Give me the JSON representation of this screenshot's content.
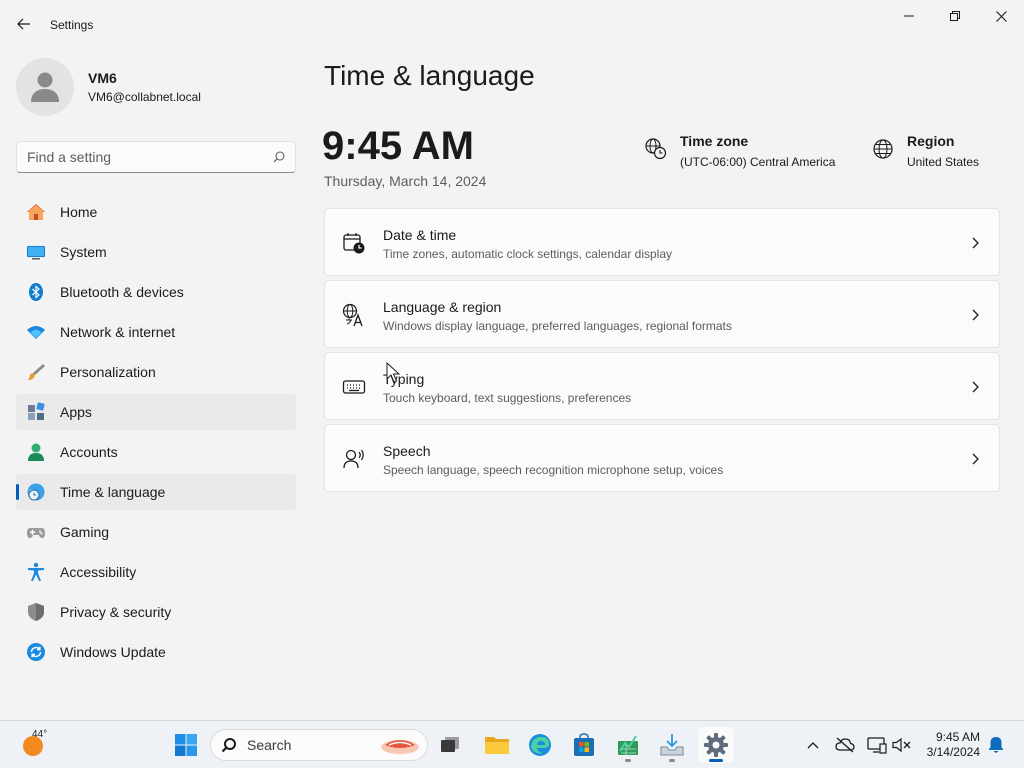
{
  "window": {
    "title": "Settings"
  },
  "user": {
    "name": "VM6",
    "email": "VM6@collabnet.local"
  },
  "search": {
    "placeholder": "Find a setting"
  },
  "sidebar": {
    "items": [
      {
        "label": "Home",
        "icon": "home-icon"
      },
      {
        "label": "System",
        "icon": "system-icon"
      },
      {
        "label": "Bluetooth & devices",
        "icon": "bluetooth-icon"
      },
      {
        "label": "Network & internet",
        "icon": "wifi-icon"
      },
      {
        "label": "Personalization",
        "icon": "brush-icon"
      },
      {
        "label": "Apps",
        "icon": "apps-icon"
      },
      {
        "label": "Accounts",
        "icon": "accounts-icon"
      },
      {
        "label": "Time & language",
        "icon": "time-language-icon",
        "active": true
      },
      {
        "label": "Gaming",
        "icon": "gamepad-icon"
      },
      {
        "label": "Accessibility",
        "icon": "accessibility-icon"
      },
      {
        "label": "Privacy & security",
        "icon": "shield-icon"
      },
      {
        "label": "Windows Update",
        "icon": "update-icon"
      }
    ]
  },
  "main": {
    "title": "Time & language",
    "clock": "9:45 AM",
    "date": "Thursday, March 14, 2024",
    "time_zone": {
      "label": "Time zone",
      "value": "(UTC-06:00) Central America"
    },
    "region": {
      "label": "Region",
      "value": "United States"
    },
    "cards": [
      {
        "title": "Date & time",
        "description": "Time zones, automatic clock settings, calendar display",
        "icon": "calendar-clock-icon"
      },
      {
        "title": "Language & region",
        "description": "Windows display language, preferred languages, regional formats",
        "icon": "language-icon"
      },
      {
        "title": "Typing",
        "description": "Touch keyboard, text suggestions, preferences",
        "icon": "keyboard-icon"
      },
      {
        "title": "Speech",
        "description": "Speech language, speech recognition microphone setup, voices",
        "icon": "speech-icon"
      }
    ]
  },
  "taskbar": {
    "weather_temp": "44°",
    "search_label": "Search",
    "time": "9:45 AM",
    "date": "3/14/2024"
  },
  "colors": {
    "accent": "#005fb8",
    "background": "#f3f3f3",
    "card": "#fbfbfb"
  }
}
